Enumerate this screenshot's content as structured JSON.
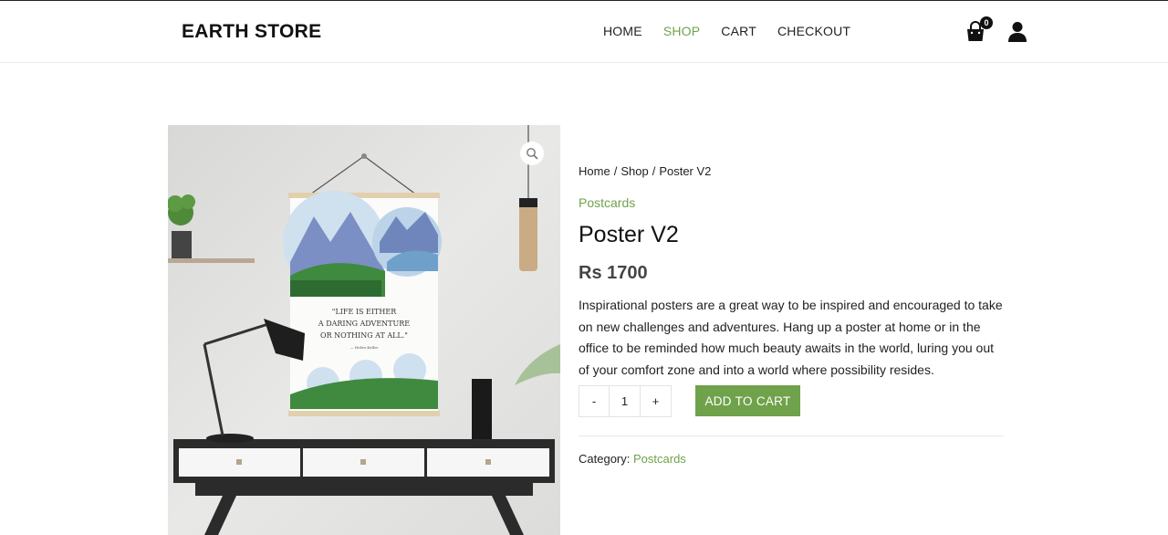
{
  "brand": "EARTH STORE",
  "nav": [
    {
      "label": "HOME"
    },
    {
      "label": "SHOP"
    },
    {
      "label": "CART"
    },
    {
      "label": "CHECKOUT"
    }
  ],
  "cart_count": "0",
  "breadcrumb": {
    "home": "Home",
    "sep": "/",
    "shop": "Shop",
    "current": "Poster V2"
  },
  "product": {
    "category_link": "Postcards",
    "title": "Poster V2",
    "price": "Rs 1700",
    "description": "Inspirational posters are a great way to be inspired and encouraged to take on new challenges and adventures. Hang up a poster at home or in the office to be reminded how much beauty awaits in the world, luring you out of your comfort zone and into a world where possibility resides.",
    "qty_minus": "-",
    "qty_value": "1",
    "qty_plus": "+",
    "add_to_cart": "ADD TO CART",
    "category_label": "Category:",
    "category_value": "Postcards"
  },
  "poster_quote": [
    "\"LIFE IS EITHER",
    "A DARING ADVENTURE",
    "OR NOTHING AT ALL.\""
  ],
  "poster_author": "— Helen Keller",
  "colors": {
    "accent": "#6fa24b",
    "text": "#222222"
  },
  "icons": {
    "cart": "shopping-bag-icon",
    "user": "user-icon",
    "zoom": "magnifier-icon"
  }
}
